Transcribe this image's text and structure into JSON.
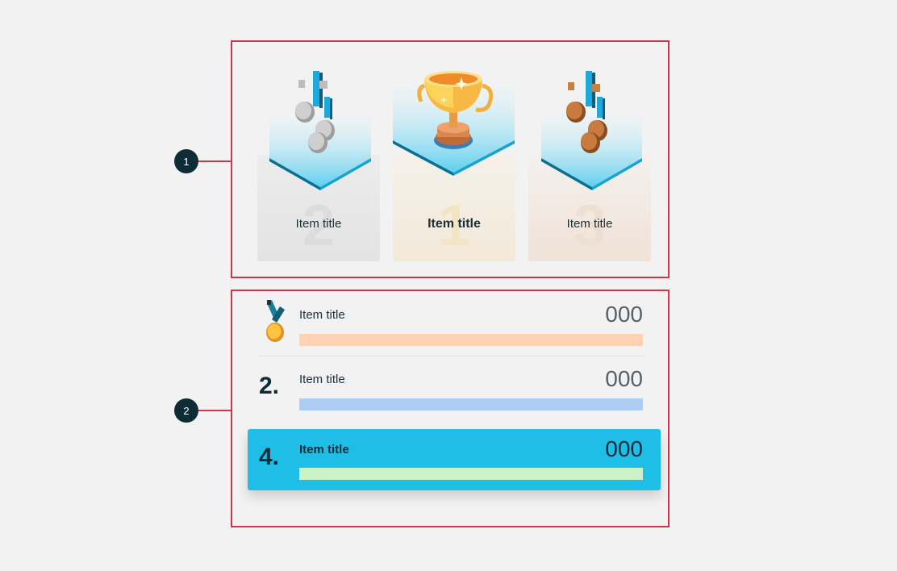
{
  "callouts": [
    {
      "label": "1"
    },
    {
      "label": "2"
    }
  ],
  "podium": {
    "items": [
      {
        "place": "2",
        "title": "Item title",
        "icon": "silver-coins-trophy-icon"
      },
      {
        "place": "1",
        "title": "Item title",
        "icon": "gold-trophy-cup-icon"
      },
      {
        "place": "3",
        "title": "Item title",
        "icon": "bronze-coins-trophy-icon"
      }
    ]
  },
  "leaderboard": {
    "rows": [
      {
        "rank": "",
        "icon": "gold-medal-icon",
        "title": "Item title",
        "score": "000",
        "bar_color": "#ffd2b3"
      },
      {
        "rank": "2.",
        "title": "Item title",
        "score": "000",
        "bar_color": "#aecdf2"
      },
      {
        "rank": "4.",
        "title": "Item title",
        "score": "000",
        "bar_color": "#cdf1c6",
        "highlighted": true
      }
    ]
  },
  "colors": {
    "annotation_red": "#d0364a",
    "callout_dark": "#0d2c36",
    "highlight_blue": "#1fbee6"
  }
}
